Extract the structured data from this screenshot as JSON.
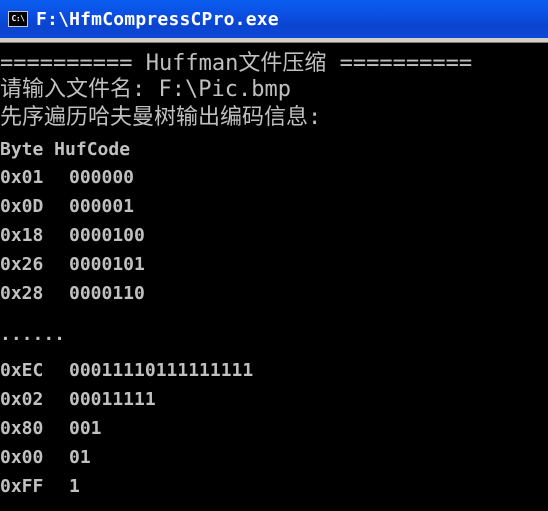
{
  "window": {
    "title": "F:\\HfmCompressCPro.exe",
    "icon": "C:\\"
  },
  "console": {
    "header": "========== Huffman文件压缩 ==========",
    "prompt_label": "请输入文件名: F:\\Pic.bmp",
    "info_line": "先序遍历哈夫曼树输出编码信息:",
    "col_headers": "Byte HufCode",
    "rows_top": [
      {
        "byte": "0x01",
        "code": "000000"
      },
      {
        "byte": "0x0D",
        "code": "000001"
      },
      {
        "byte": "0x18",
        "code": "0000100"
      },
      {
        "byte": "0x26",
        "code": "0000101"
      },
      {
        "byte": "0x28",
        "code": "0000110"
      }
    ],
    "ellipsis": "......",
    "rows_bottom": [
      {
        "byte": "0xEC",
        "code": "00011110111111111"
      },
      {
        "byte": "0x02",
        "code": "00011111"
      },
      {
        "byte": "0x80",
        "code": "001"
      },
      {
        "byte": "0x00",
        "code": "01"
      },
      {
        "byte": "0xFF",
        "code": "1"
      }
    ]
  },
  "colors": {
    "titlebar": "#0b4ee0",
    "console_bg": "#000000",
    "console_text": "#c0c0c0"
  }
}
